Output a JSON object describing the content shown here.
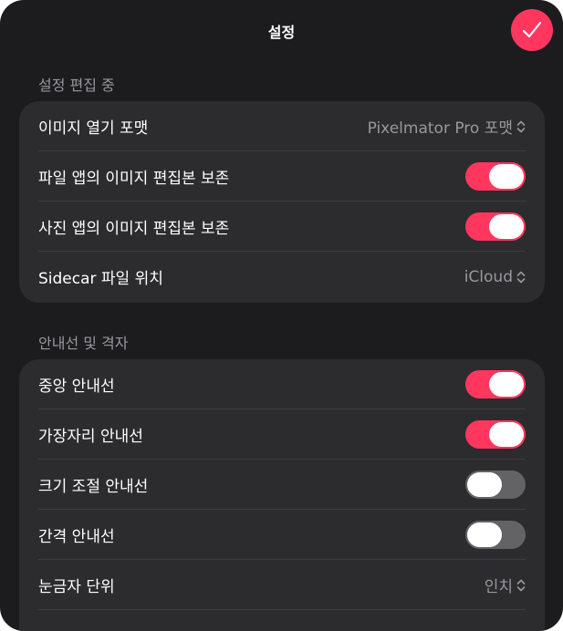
{
  "header": {
    "title": "설정",
    "done_icon": "checkmark-icon",
    "accent_color": "#ff375f"
  },
  "sections": [
    {
      "title": "설정 편집 중",
      "rows": [
        {
          "label": "이미지 열기 포맷",
          "type": "picker",
          "value": "Pixelmator Pro 포맷"
        },
        {
          "label": "파일 앱의 이미지 편집본 보존",
          "type": "toggle",
          "on": true
        },
        {
          "label": "사진 앱의 이미지 편집본 보존",
          "type": "toggle",
          "on": true
        },
        {
          "label": "Sidecar 파일 위치",
          "type": "picker",
          "value": "iCloud"
        }
      ]
    },
    {
      "title": "안내선 및 격자",
      "rows": [
        {
          "label": "중앙 안내선",
          "type": "toggle",
          "on": true
        },
        {
          "label": "가장자리 안내선",
          "type": "toggle",
          "on": true
        },
        {
          "label": "크기 조절 안내선",
          "type": "toggle",
          "on": false
        },
        {
          "label": "간격 안내선",
          "type": "toggle",
          "on": false
        },
        {
          "label": "눈금자 단위",
          "type": "picker",
          "value": "인치"
        }
      ]
    }
  ]
}
